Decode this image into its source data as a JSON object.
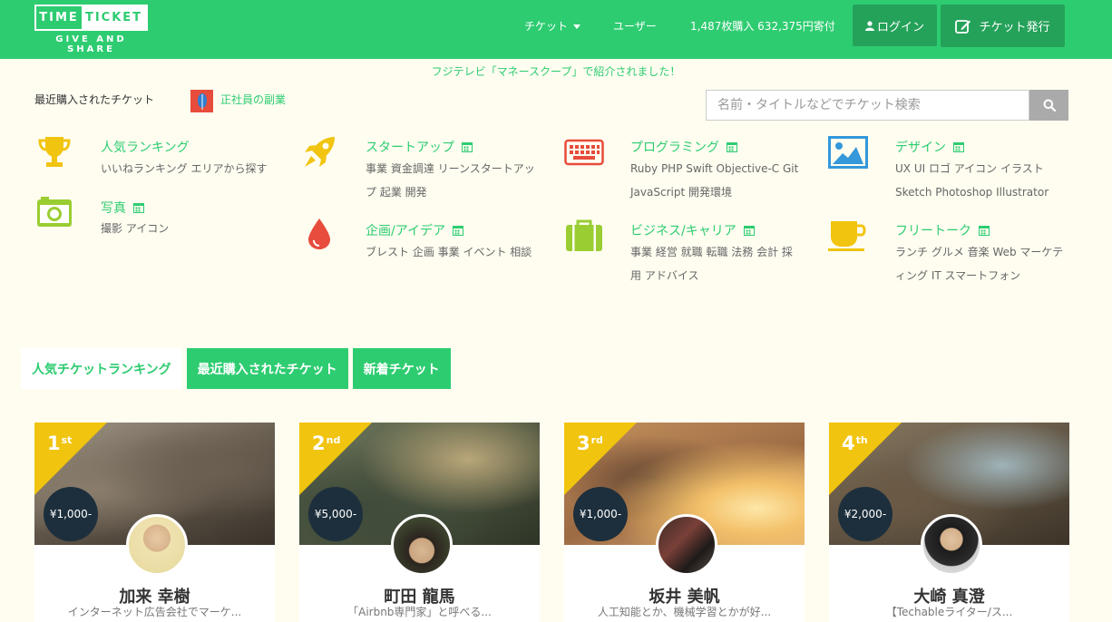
{
  "logo": {
    "word1": "TIME",
    "word2": "TICKET",
    "tagline": "GIVE AND SHARE"
  },
  "nav": {
    "ticket_menu": "チケット",
    "users": "ユーザー",
    "stats": "1,487枚購入 632,375円寄付",
    "login": "ログイン",
    "publish": "チケット発行"
  },
  "announcement": "フジテレビ「マネースクープ」で紹介されました！",
  "recent": {
    "label": "最近購入されたチケット",
    "link": "正社員の副業"
  },
  "search": {
    "placeholder": "名前・タイトルなどでチケット検索"
  },
  "categories": [
    {
      "title": "人気ランキング",
      "tags": "いいねランキング エリアから探す",
      "icon": "trophy-icon",
      "color": "#f1c40f"
    },
    {
      "title": "スタートアップ",
      "tags": "事業 資金調達 リーンスタートアップ 起業 開発",
      "icon": "rocket-icon",
      "color": "#f1c40f"
    },
    {
      "title": "プログラミング",
      "tags": "Ruby PHP Swift Objective-C Git JavaScript 開発環境",
      "icon": "keyboard-icon",
      "color": "#e74c3c"
    },
    {
      "title": "デザイン",
      "tags": "UX UI ロゴ アイコン イラスト Sketch Photoshop Illustrator",
      "icon": "image-icon",
      "color": "#3498db"
    },
    {
      "title": "写真",
      "tags": "撮影 アイコン",
      "icon": "camera-icon",
      "color": "#9acd32"
    },
    {
      "title": "企画/アイデア",
      "tags": "ブレスト 企画 事業 イベント 相談",
      "icon": "drop-icon",
      "color": "#e74c3c"
    },
    {
      "title": "ビジネス/キャリア",
      "tags": "事業 経営 就職 転職 法務 会計 採用 アドバイス",
      "icon": "briefcase-icon",
      "color": "#9acd32"
    },
    {
      "title": "フリートーク",
      "tags": "ランチ グルメ 音楽 Web マーケティング IT スマートフォン",
      "icon": "coffee-icon",
      "color": "#f1c40f"
    }
  ],
  "tabs": [
    {
      "label": "人気チケットランキング",
      "active": true
    },
    {
      "label": "最近購入されたチケット",
      "active": false
    },
    {
      "label": "新着チケット",
      "active": false
    }
  ],
  "cards": [
    {
      "rank": "1",
      "suffix": "st",
      "price": "¥1,000-",
      "name": "加来 幸樹",
      "desc": "インターネット広告会社でマーケ..."
    },
    {
      "rank": "2",
      "suffix": "nd",
      "price": "¥5,000-",
      "name": "町田 龍馬",
      "desc": "「Airbnb専門家」と呼べる..."
    },
    {
      "rank": "3",
      "suffix": "rd",
      "price": "¥1,000-",
      "name": "坂井 美帆",
      "desc": "人工知能とか、機械学習とかが好..."
    },
    {
      "rank": "4",
      "suffix": "th",
      "price": "¥2,000-",
      "name": "大崎 真澄",
      "desc": "【Techableライター/ス..."
    }
  ]
}
